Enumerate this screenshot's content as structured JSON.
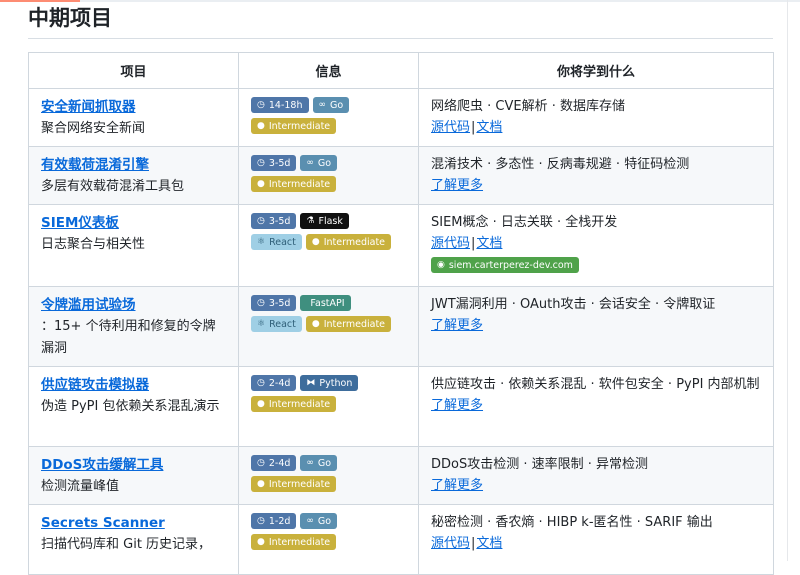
{
  "section": {
    "title": "中期项目"
  },
  "table": {
    "headers": [
      "项目",
      "信息",
      "你将学到什么"
    ],
    "rows": [
      {
        "name": "安全新闻抓取器",
        "desc": "聚合网络安全新闻",
        "badges": [
          {
            "text": "14-18h",
            "kind": "dur",
            "icon": "clock-icon"
          },
          {
            "text": "Go",
            "kind": "go",
            "icon": "go-icon"
          },
          {
            "text": "Intermediate",
            "kind": "level",
            "icon": "dot-icon"
          }
        ],
        "learn": "网络爬虫 · CVE解析 · 数据库存储",
        "links": [
          "源代码",
          "文档"
        ],
        "link_sep": "|"
      },
      {
        "name": "有效载荷混淆引擎",
        "desc": "多层有效载荷混淆工具包",
        "badges": [
          {
            "text": "3-5d",
            "kind": "dur",
            "icon": "clock-icon"
          },
          {
            "text": "Go",
            "kind": "go",
            "icon": "go-icon"
          },
          {
            "text": "Intermediate",
            "kind": "level",
            "icon": "dot-icon"
          }
        ],
        "learn": "混淆技术 · 多态性 · 反病毒规避 · 特征码检测",
        "more": "了解更多"
      },
      {
        "name": "SIEM仪表板",
        "desc": "日志聚合与相关性",
        "badges": [
          {
            "text": "3-5d",
            "kind": "dur",
            "icon": "clock-icon"
          },
          {
            "text": "Flask",
            "kind": "flask",
            "icon": "flask-icon"
          },
          {
            "text": "React",
            "kind": "react",
            "icon": "react-icon"
          },
          {
            "text": "Intermediate",
            "kind": "level",
            "icon": "dot-icon"
          }
        ],
        "learn": "SIEM概念 · 日志关联 · 全栈开发",
        "links": [
          "源代码",
          "文档"
        ],
        "link_sep": "|",
        "site": "siem.carterperez-dev.com"
      },
      {
        "name": "令牌滥用试验场",
        "desc": "：15+ 个待利用和修复的令牌漏洞",
        "badges": [
          {
            "text": "3-5d",
            "kind": "dur",
            "icon": "clock-icon"
          },
          {
            "text": "FastAPI",
            "kind": "fastapi",
            "icon": "fastapi-icon"
          },
          {
            "text": "React",
            "kind": "react",
            "icon": "react-icon"
          },
          {
            "text": "Intermediate",
            "kind": "level",
            "icon": "dot-icon"
          }
        ],
        "learn": "JWT漏洞利用 · OAuth攻击 · 会话安全 · 令牌取证",
        "more": "了解更多"
      },
      {
        "name": "供应链攻击模拟器",
        "desc": "伪造 PyPI 包依赖关系混乱演示",
        "badges": [
          {
            "text": "2-4d",
            "kind": "dur",
            "icon": "clock-icon"
          },
          {
            "text": "Python",
            "kind": "python",
            "icon": "python-icon"
          },
          {
            "text": "Intermediate",
            "kind": "level",
            "icon": "dot-icon"
          }
        ],
        "learn": "供应链攻击 · 依赖关系混乱 · 软件包安全 · PyPI 内部机制",
        "more": "了解更多"
      },
      {
        "name": "DDoS攻击缓解工具",
        "desc": "检测流量峰值",
        "badges": [
          {
            "text": "2-4d",
            "kind": "dur",
            "icon": "clock-icon"
          },
          {
            "text": "Go",
            "kind": "go",
            "icon": "go-icon"
          },
          {
            "text": "Intermediate",
            "kind": "level",
            "icon": "dot-icon"
          }
        ],
        "learn": "DDoS攻击检测 · 速率限制 · 异常检测",
        "more": "了解更多"
      },
      {
        "name": "Secrets Scanner",
        "desc": "扫描代码库和 Git 历史记录，",
        "badges": [
          {
            "text": "1-2d",
            "kind": "dur",
            "icon": "clock-icon"
          },
          {
            "text": "Go",
            "kind": "go",
            "icon": "go-icon"
          },
          {
            "text": "Intermediate",
            "kind": "level",
            "icon": "dot-icon"
          }
        ],
        "learn": "秘密检测 · 香农熵 · HIBP k-匿名性 · SARIF 输出",
        "links": [
          "源代码",
          "文档"
        ],
        "link_sep": "|"
      }
    ]
  }
}
